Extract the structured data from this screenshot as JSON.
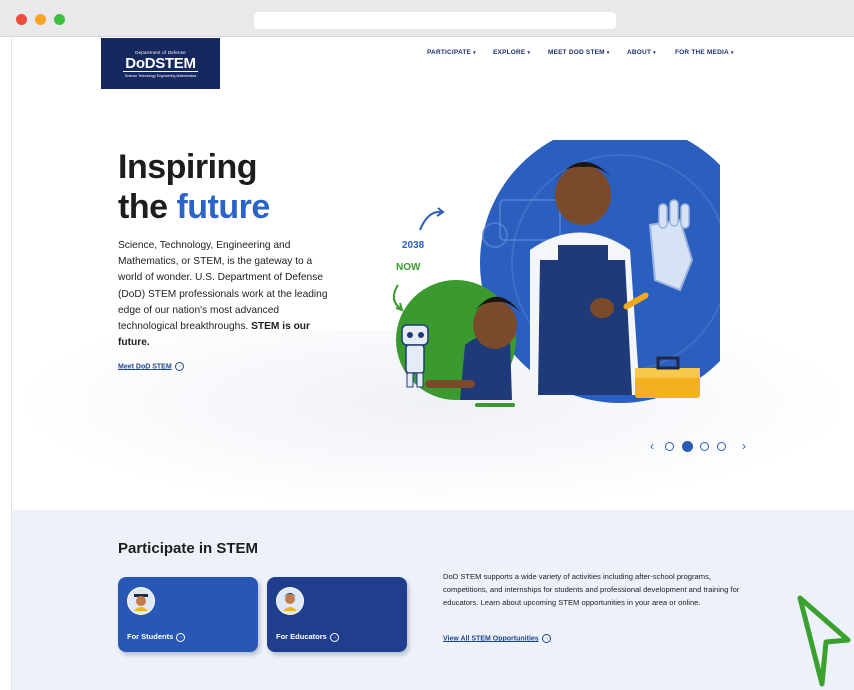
{
  "browser": {
    "buttons": [
      "close",
      "minimize",
      "maximize"
    ],
    "colors": {
      "close": "#ee4b3c",
      "minimize": "#f6a623",
      "maximize": "#3cc23f"
    }
  },
  "header": {
    "logo": {
      "top_text": "Department of Defense",
      "main_text": "DoDSTEM",
      "sub_text": "Science Technology Engineering Mathematics"
    },
    "nav": [
      {
        "label": "PARTICIPATE"
      },
      {
        "label": "EXPLORE"
      },
      {
        "label": "MEET DOD STEM"
      },
      {
        "label": "ABOUT"
      },
      {
        "label": "FOR THE MEDIA"
      }
    ]
  },
  "hero": {
    "title_line1": "Inspiring",
    "title_line2_prefix": "the ",
    "title_line2_accent": "future",
    "body": "Science, Technology, Engineering and Mathematics, or STEM, is the gateway to a world of wonder. U.S. Department of Defense (DoD) STEM professionals work at the leading edge of our nation's most advanced technological breakthroughs.",
    "body_bold": "STEM is our future.",
    "link": "Meet DoD STEM",
    "illustration": {
      "label_future": "2038",
      "label_now": "NOW"
    },
    "carousel": {
      "slides": 4,
      "active_index": 1,
      "prev": "‹",
      "next": "›"
    }
  },
  "participate": {
    "title": "Participate in STEM",
    "cards": [
      {
        "label": "For Students",
        "icon": "graduate-student-icon"
      },
      {
        "label": "For Educators",
        "icon": "educator-icon"
      }
    ],
    "description": "DoD STEM supports a wide variety of activities including after-school programs, competitions, and internships for students and professional development and training for educators. Learn about upcoming STEM opportunities in your area or online.",
    "link": "View All STEM Opportunities"
  },
  "colors": {
    "brand_navy": "#15285f",
    "accent_blue": "#2b63c7",
    "accent_green": "#3b9a2f",
    "section_bg": "#edf1f9",
    "cursor_green": "#3aa12f"
  }
}
